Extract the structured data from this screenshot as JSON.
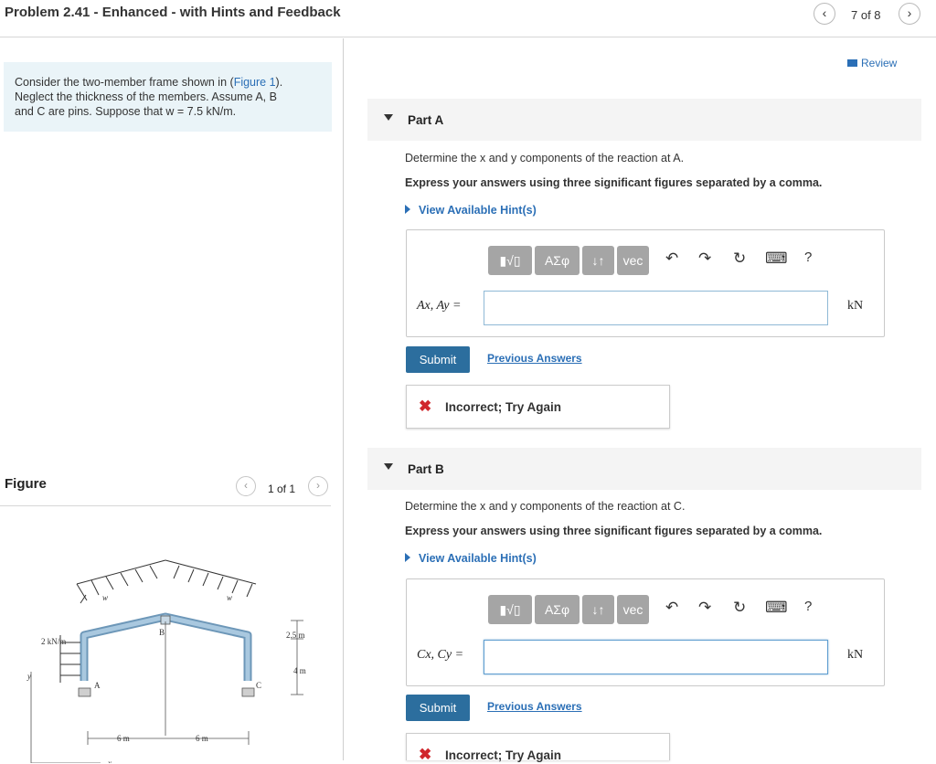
{
  "header": {
    "title": "Problem 2.41 - Enhanced - with Hints and Feedback",
    "pager": "7 of 8"
  },
  "problem": {
    "line1": "Consider the two-member frame shown in (",
    "figure_link": "Figure 1",
    "line1_end": ").",
    "line2": "Neglect the thickness of the members. Assume A, B",
    "line3": "and C are pins. Suppose that w = 7.5 kN/m."
  },
  "figure": {
    "title": "Figure",
    "pager": "1 of 1",
    "labels": {
      "w": "w",
      "B": "B",
      "A": "A",
      "C": "C",
      "y": "y",
      "x": "x",
      "load": "2 kN/m",
      "h1": "2.5 m",
      "h2": "4 m",
      "d1": "6 m",
      "d2": "6 m"
    }
  },
  "review": "Review",
  "parts": [
    {
      "label": "Part A",
      "question": "Determine the x and y components of the reaction at A.",
      "instruction": "Express your answers using three significant figures separated by a comma.",
      "hint": "View Available Hint(s)",
      "answer_label": "Ax, Ay =",
      "unit": "kN",
      "input_value": "",
      "submit": "Submit",
      "previous": "Previous Answers",
      "feedback": "Incorrect; Try Again"
    },
    {
      "label": "Part B",
      "question": "Determine the x and y components of the reaction at C.",
      "instruction": "Express your answers using three significant figures separated by a comma.",
      "hint": "View Available Hint(s)",
      "answer_label": "Cx, Cy =",
      "unit": "kN",
      "input_value": "",
      "submit": "Submit",
      "previous": "Previous Answers",
      "feedback": "Incorrect; Try Again"
    }
  ],
  "toolbar": {
    "templates": "▮√▯",
    "greek": "ΑΣφ",
    "arrows": "↓↑",
    "vec": "vec",
    "undo": "↶",
    "redo": "↷",
    "reset": "↻",
    "keyboard": "⌨",
    "help": "?"
  },
  "colors": {
    "accent": "#2b6fb6",
    "submit": "#2c6e9e",
    "error": "#d0262c",
    "problem_bg": "#eaf4f8"
  }
}
